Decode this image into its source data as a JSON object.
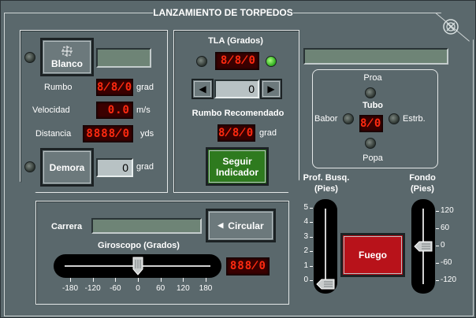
{
  "title": "LANZAMIENTO DE TORPEDOS",
  "icons": {
    "close": "close-icon",
    "target": "crosshair-icon",
    "left": "left-arrow-icon",
    "right": "right-arrow-icon"
  },
  "target": {
    "blanco_label": "Blanco",
    "rumbo_label": "Rumbo",
    "rumbo_value": "8̸8̸0",
    "rumbo_unit": "grad",
    "velocidad_label": "Velocidad",
    "velocidad_value": "0.0",
    "velocidad_unit": "m/s",
    "distancia_label": "Distancia",
    "distancia_value": "8888̸0",
    "distancia_unit": "yds",
    "demora_label": "Demora",
    "demora_value": "0",
    "demora_unit": "grad"
  },
  "tla": {
    "label": "TLA (Grados)",
    "value": "8̸8̸0",
    "stepper_value": "0",
    "rumbo_rec_label": "Rumbo Recomendado",
    "rumbo_rec_value": "8̸8̸0",
    "rumbo_rec_unit": "grad",
    "seguir_label_1": "Seguir",
    "seguir_label_2": "Indicador"
  },
  "tubes": {
    "proa": "Proa",
    "popa": "Popa",
    "babor": "Babor",
    "estrb": "Estrb.",
    "tubo_label": "Tubo",
    "tubo_value": "8̸0"
  },
  "run": {
    "carrera_label": "Carrera",
    "circular_label": "Circular",
    "giroscopo_label": "Giroscopo (Grados)",
    "giroscopo_value": "888̸0",
    "scale": [
      "-180",
      "-120",
      "-60",
      "0",
      "60",
      "120",
      "180"
    ],
    "gyro_value_deg": 0
  },
  "depth": {
    "busq_label_1": "Prof. Busq.",
    "busq_label_2": "(Pies)",
    "busq_scale": [
      "5",
      "4",
      "3",
      "2",
      "1",
      "0"
    ],
    "busq_value": 0,
    "fondo_label_1": "Fondo",
    "fondo_label_2": "(Pies)",
    "fondo_scale": [
      "120",
      "60",
      "0",
      "-60",
      "-120"
    ],
    "fondo_value": 0
  },
  "fire_label": "Fuego",
  "colors": {
    "fire": "#b8121a",
    "seguir": "#2e7a1e",
    "led": "#ff2a10",
    "led_bg": "#3a0000"
  }
}
